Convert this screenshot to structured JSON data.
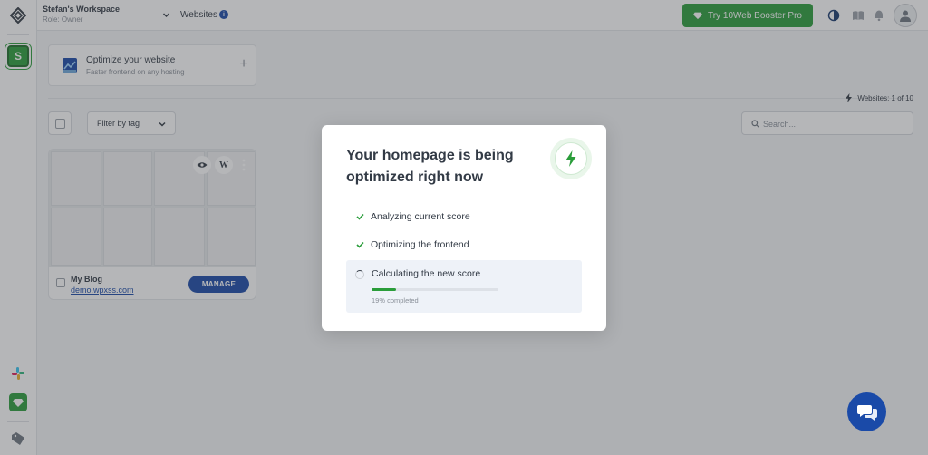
{
  "workspace": {
    "name": "Stefan's Workspace",
    "role": "Role: Owner",
    "initial": "S"
  },
  "topbar": {
    "section": "Websites",
    "info_glyph": "i",
    "cta_label": "Try 10Web Booster Pro"
  },
  "optimize_card": {
    "title": "Optimize your website",
    "subtitle": "Faster frontend on any hosting",
    "plus": "+"
  },
  "websites_count": "Websites: 1 of 10",
  "toolbar": {
    "filter_label": "Filter by tag",
    "search_placeholder": "Search..."
  },
  "sites": [
    {
      "name": "My Blog",
      "url": "demo.wpxss.com",
      "manage_label": "MANAGE",
      "wp_glyph": "W"
    }
  ],
  "modal": {
    "title": "Your homepage is being optimized right now",
    "steps": [
      {
        "label": "Analyzing current score",
        "status": "done"
      },
      {
        "label": "Optimizing the frontend",
        "status": "done"
      },
      {
        "label": "Calculating the new score",
        "status": "in-progress"
      }
    ],
    "progress_percent": 19,
    "progress_text": "19% completed"
  },
  "colors": {
    "brand_green": "#2a9d3a",
    "brand_blue": "#1a4aa8",
    "text": "#323a45",
    "muted": "#8a9099"
  },
  "icons": [
    "logo-icon",
    "slack-icon",
    "gem-icon",
    "tag-icon",
    "chevron-down-icon",
    "info-icon",
    "theme-toggle-icon",
    "book-icon",
    "bell-icon",
    "avatar-icon",
    "bolt-icon",
    "eye-icon",
    "wordpress-icon",
    "more-icon",
    "search-icon",
    "check-icon",
    "spinner-icon",
    "chat-icon"
  ]
}
